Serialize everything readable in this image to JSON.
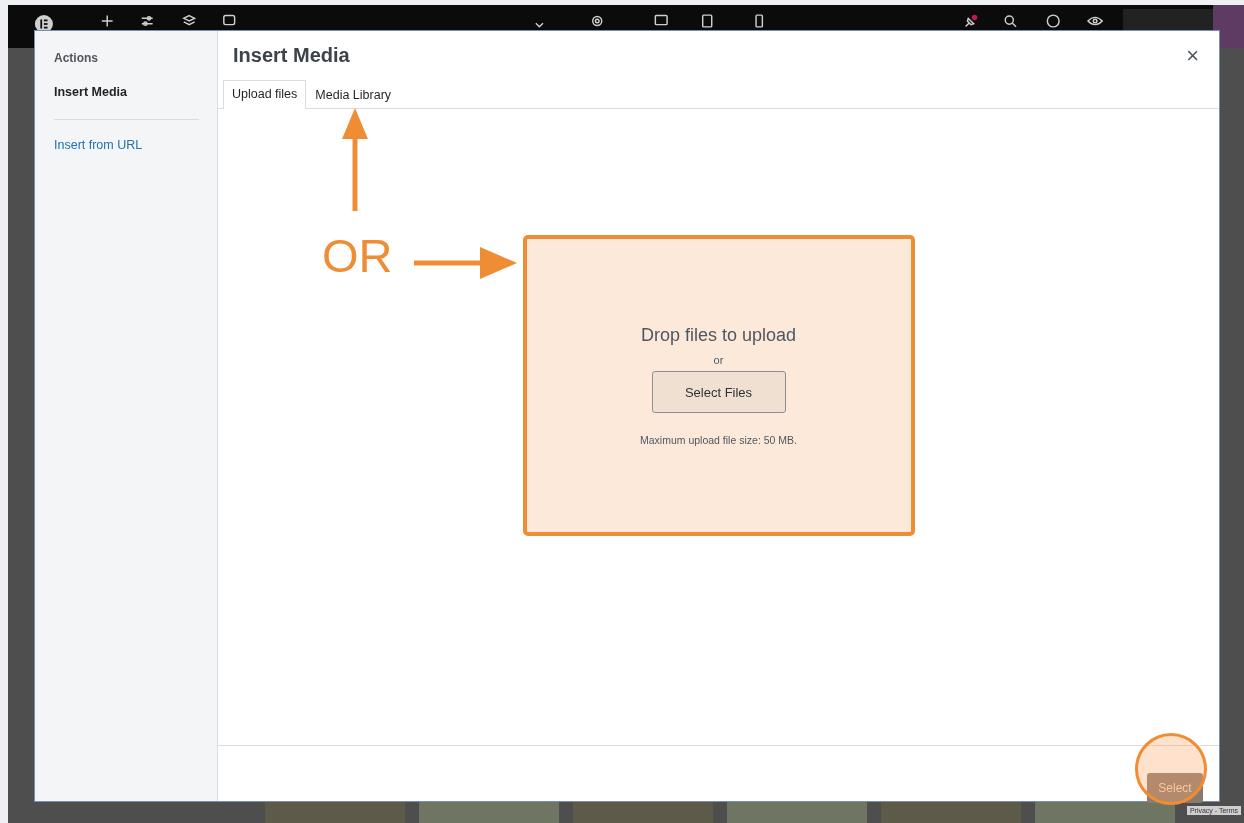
{
  "modal": {
    "sidebar": {
      "heading": "Actions",
      "items": [
        {
          "label": "Insert Media",
          "selected": true
        },
        {
          "label": "Insert from URL",
          "selected": false
        }
      ]
    },
    "title": "Insert Media",
    "close": "×",
    "tabs": [
      {
        "label": "Upload files",
        "selected": true
      },
      {
        "label": "Media Library",
        "selected": false
      }
    ],
    "dropzone": {
      "title": "Drop files to upload",
      "or": "or",
      "button": "Select Files",
      "note": "Maximum upload file size: 50 MB.",
      "highlighted": true
    },
    "footer": {
      "select_button": "Select",
      "select_highlighted": true
    }
  },
  "annotations": [
    {
      "kind": "label",
      "text": "OR"
    },
    {
      "kind": "arrow-up"
    },
    {
      "kind": "arrow-right"
    }
  ],
  "background": {
    "recaptcha": "Privacy - Terms"
  }
}
